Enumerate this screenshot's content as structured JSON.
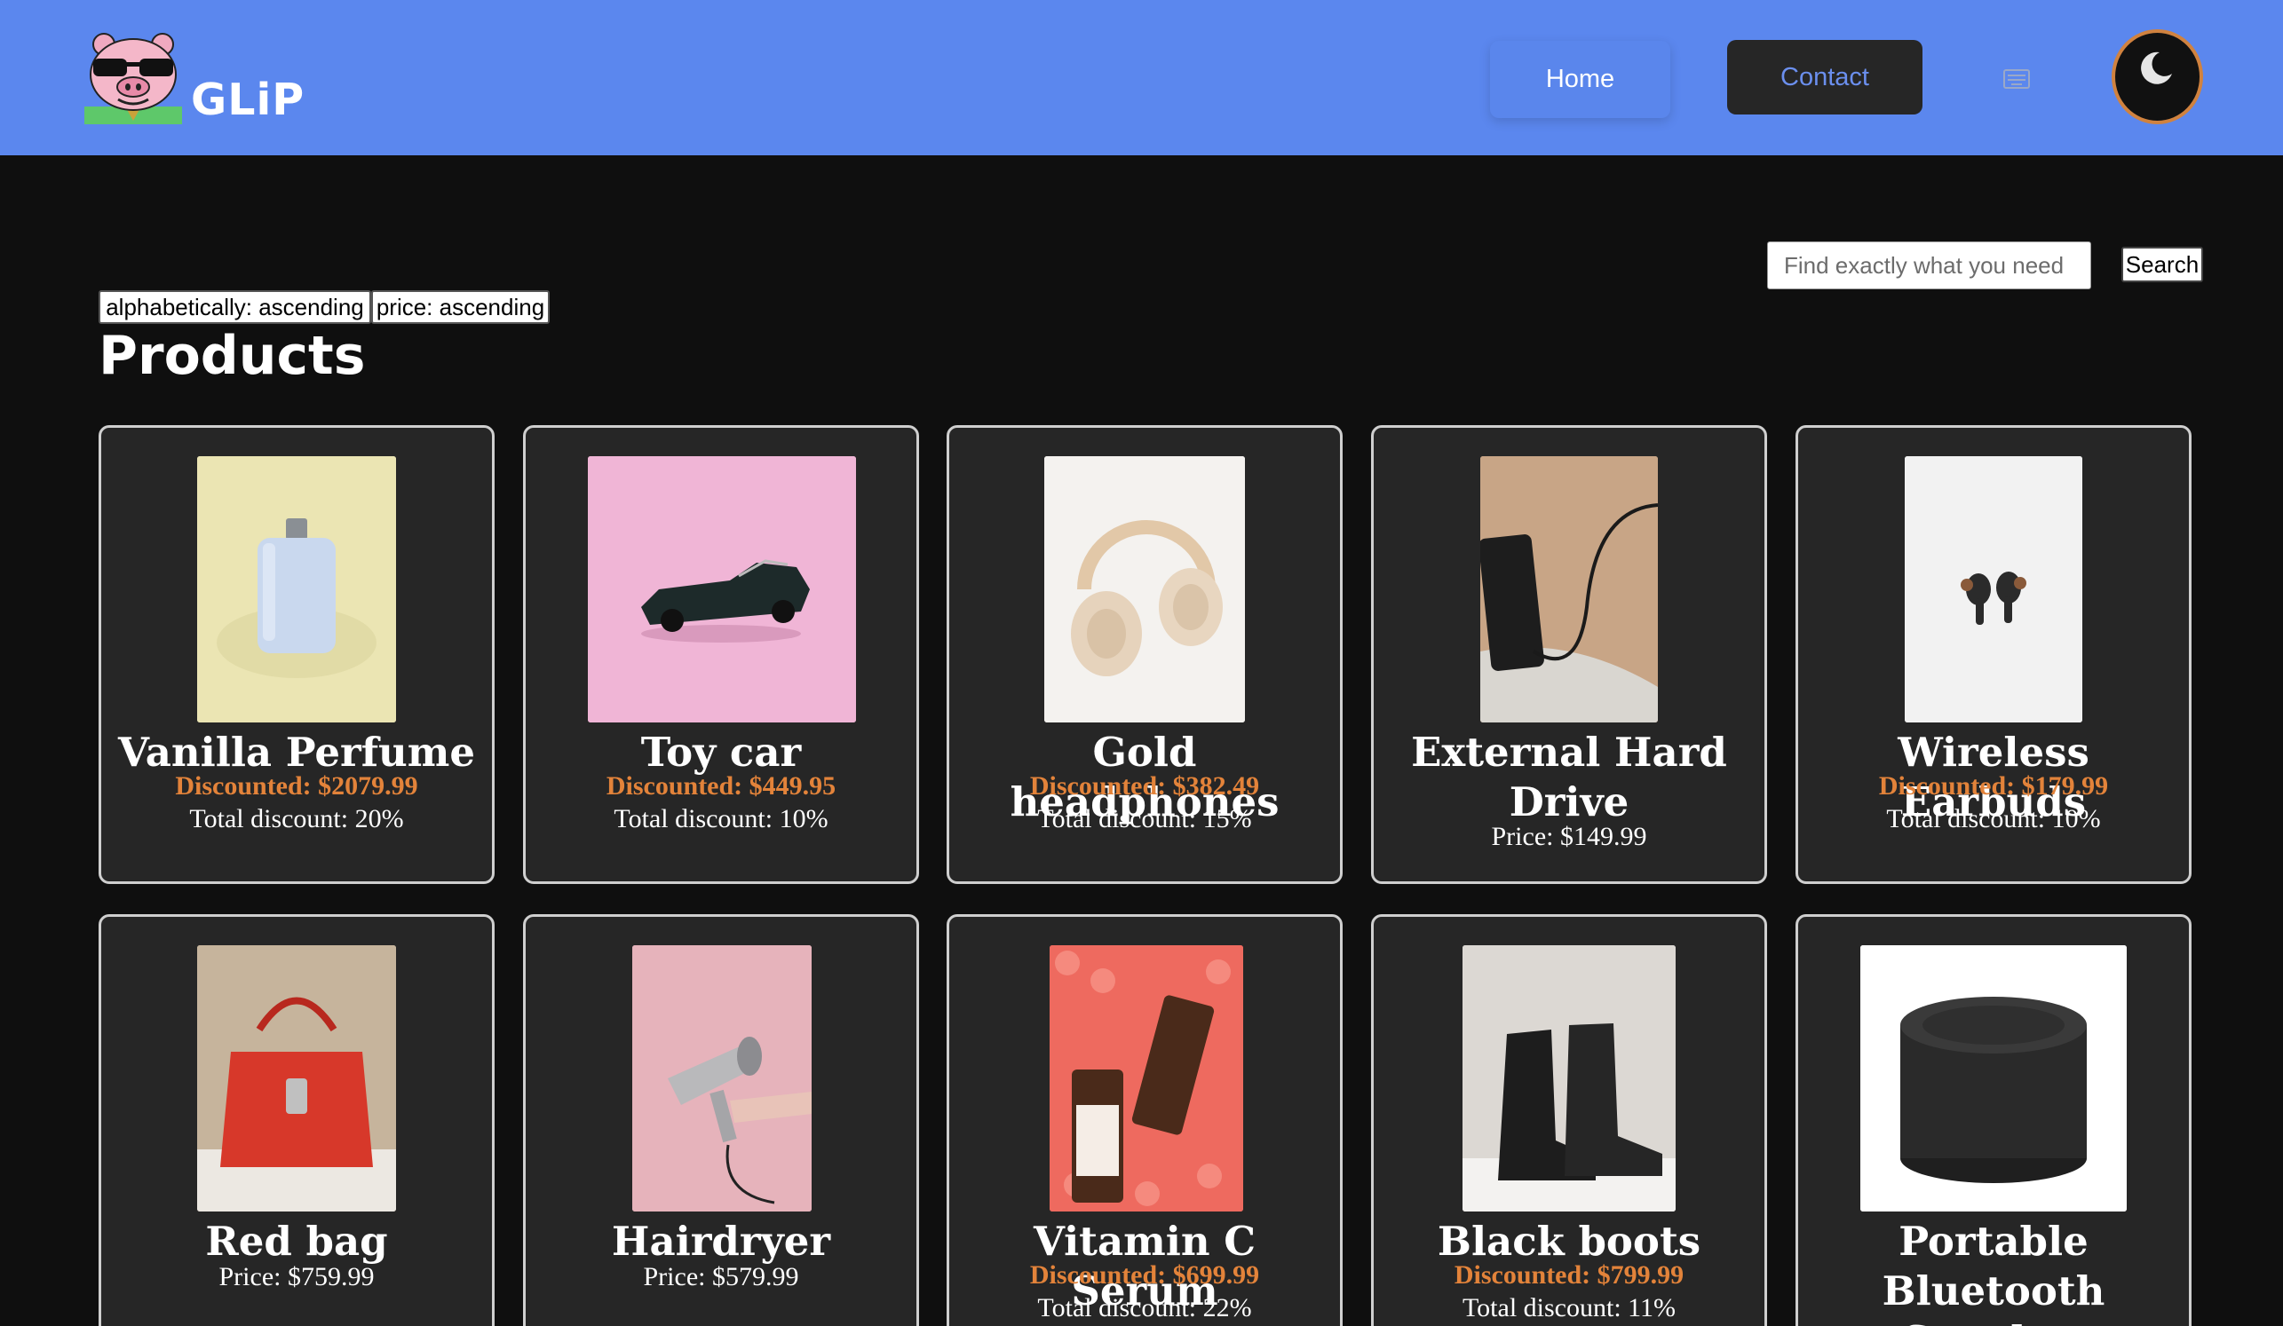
{
  "header": {
    "brand": "GLiP",
    "nav": {
      "home": "Home",
      "contact": "Contact"
    }
  },
  "search": {
    "placeholder": "Find exactly what you need",
    "button": "Search"
  },
  "sort": {
    "alphabetical": "alphabetically: ascending",
    "price": "price: ascending"
  },
  "page_title": "Products",
  "products": [
    {
      "name": "Vanilla Perfume",
      "discounted": "Discounted: $2079.99",
      "detail": "Total discount: 20%"
    },
    {
      "name": "Toy car",
      "discounted": "Discounted: $449.95",
      "detail": "Total discount: 10%"
    },
    {
      "name": "Gold headphones",
      "discounted": "Discounted: $382.49",
      "detail": "Total discount: 15%"
    },
    {
      "name": "External Hard Drive",
      "detail": "Price: $149.99"
    },
    {
      "name": "Wireless Earbuds",
      "discounted": "Discounted: $179.99",
      "detail": "Total discount: 10%"
    },
    {
      "name": "Red bag",
      "detail": "Price: $759.99"
    },
    {
      "name": "Hairdryer",
      "detail": "Price: $579.99"
    },
    {
      "name": "Vitamin C Serum",
      "discounted": "Discounted: $699.99",
      "detail": "Total discount: 22%"
    },
    {
      "name": "Black boots",
      "discounted": "Discounted: $799.99",
      "detail": "Total discount: 11%"
    },
    {
      "name": "Portable Bluetooth Speaker"
    }
  ],
  "colors": {
    "navbar": "#5b87ee",
    "background": "#0f0f0f",
    "card": "#262626",
    "discount": "#e3833a",
    "contact_text": "#6b8fee",
    "theme_ring": "#d0823f"
  },
  "icons": {
    "logo": "pig-sunglasses-logo",
    "nav_extra": "keyboard-icon",
    "theme": "moon-icon"
  }
}
